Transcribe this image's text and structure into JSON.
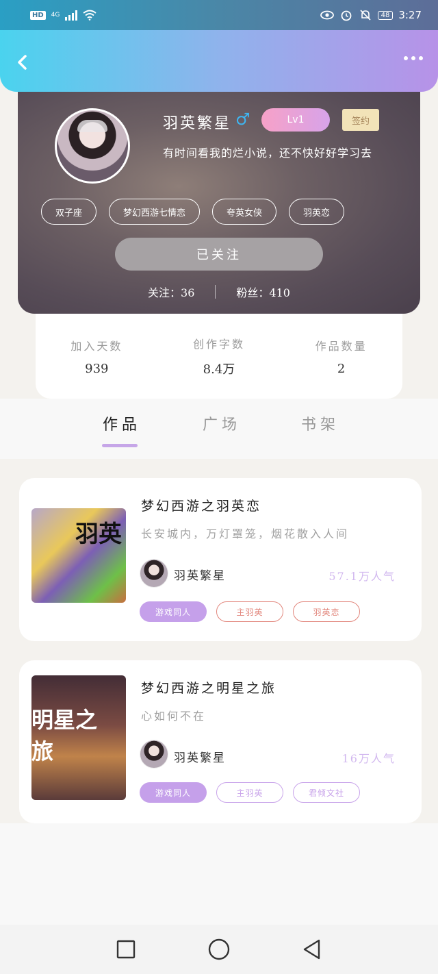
{
  "status_bar": {
    "hd": "HD",
    "network": "4G",
    "battery": "48",
    "time": "3:27"
  },
  "header": {
    "back_icon": "chevron-left-icon",
    "more_icon": "more-dots-icon"
  },
  "profile": {
    "name": "羽英繁星",
    "gender_symbol": "♂",
    "level": "Lv1",
    "sign_badge": "签约",
    "bio": "有时间看我的烂小说，还不快好好学习去",
    "tags": [
      "双子座",
      "梦幻西游七情恋",
      "夸英女侠",
      "羽英恋"
    ],
    "follow_button": "已关注",
    "following": "关注：36",
    "followers": "粉丝：410",
    "colors": {
      "gender": "#3fb5f0",
      "level_start": "#f7a1c7",
      "level_end": "#d7a3e9"
    }
  },
  "stats": [
    {
      "label": "加入天数",
      "value": "939"
    },
    {
      "label": "创作字数",
      "value": "8.4万"
    },
    {
      "label": "作品数量",
      "value": "2"
    }
  ],
  "tabs": [
    {
      "label": "作品",
      "active": true
    },
    {
      "label": "广场",
      "active": false
    },
    {
      "label": "书架",
      "active": false
    }
  ],
  "works": [
    {
      "title": "梦幻西游之羽英恋",
      "description": "长安城内，万灯罩笼，烟花散入人间",
      "cover_text": "羽英",
      "author": "羽英繁星",
      "popularity": "57.1万人气",
      "tags": [
        "游戏同人",
        "主羽英",
        "羽英恋"
      ]
    },
    {
      "title": "梦幻西游之明星之旅",
      "description": "心如何不在",
      "cover_text": "明星之旅",
      "author": "羽英繁星",
      "popularity": "16万人气",
      "tags": [
        "游戏同人",
        "主羽英",
        "君倾文社"
      ]
    }
  ],
  "nav": {
    "recent": "square-icon",
    "home": "circle-icon",
    "back": "triangle-back-icon"
  }
}
